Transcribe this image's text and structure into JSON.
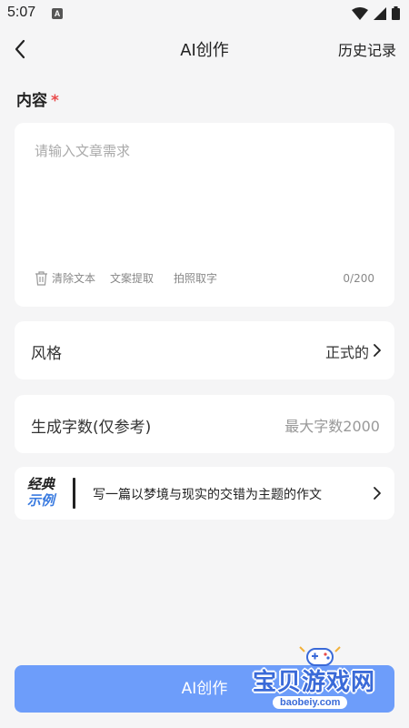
{
  "status_bar": {
    "time": "5:07",
    "notification_badge": "A"
  },
  "nav": {
    "title": "AI创作",
    "history_label": "历史记录"
  },
  "content": {
    "label": "内容",
    "required_mark": "*",
    "placeholder": "请输入文章需求",
    "value": "",
    "clear_label": "清除文本",
    "extract_label": "文案提取",
    "photo_label": "拍照取字",
    "char_count": "0/200"
  },
  "style_row": {
    "label": "风格",
    "value": "正式的"
  },
  "wordcount_row": {
    "label": "生成字数(仅参考)",
    "placeholder": "最大字数2000"
  },
  "example": {
    "badge_line1": "经典",
    "badge_line2": "示例",
    "text": "写一篇以梦境与现实的交错为主题的作文"
  },
  "primary_button": {
    "label": "AI创作"
  },
  "watermark": {
    "text": "宝贝游戏网",
    "url": "baobeiy.com"
  },
  "colors": {
    "accent_button": "#6d9dfa",
    "required": "#e94a4a",
    "example_badge": "#3a7be0",
    "background": "#f5f5f6"
  },
  "icons": [
    "back-arrow-icon",
    "wifi-icon",
    "signal-icon",
    "battery-icon",
    "trash-icon",
    "chevron-right-icon",
    "gamepad-icon"
  ]
}
